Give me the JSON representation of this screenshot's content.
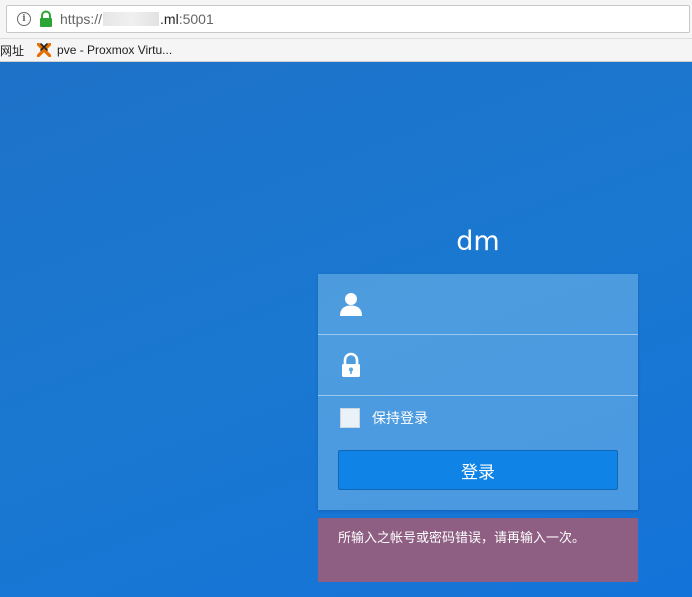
{
  "browser": {
    "url_scheme": "https://",
    "url_host": ".ml",
    "url_port": ":5001",
    "bookmarks": [
      {
        "label": "网址"
      },
      {
        "label": "pve - Proxmox Virtu..."
      }
    ]
  },
  "page": {
    "title": "dm",
    "remember_label": "保持登录",
    "login_label": "登录",
    "error_message": "所输入之帐号或密码错误，请再输入一次。"
  },
  "icons": {
    "info": "info-icon",
    "lock_secure": "lock-icon",
    "pve": "proxmox-icon",
    "user": "user-icon",
    "password": "padlock-icon"
  }
}
